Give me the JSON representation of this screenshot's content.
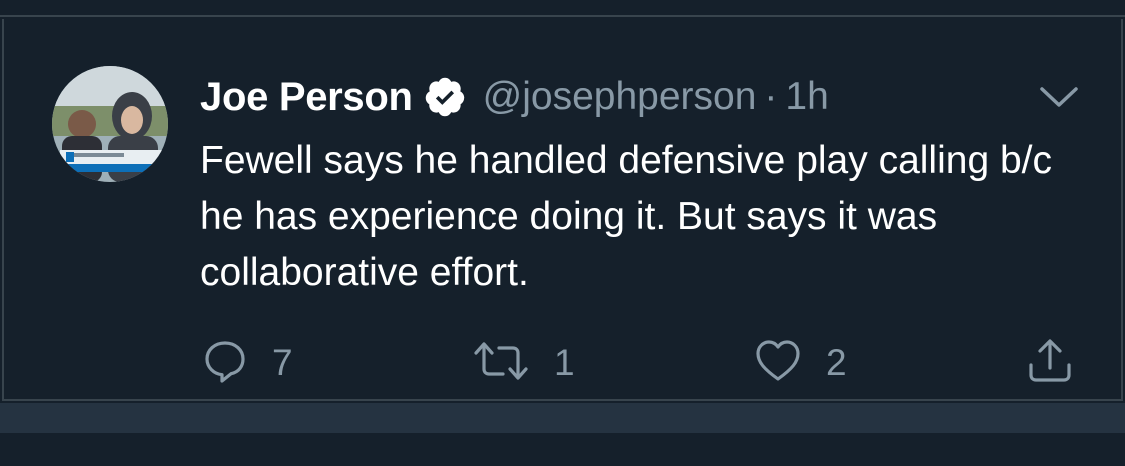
{
  "tweet": {
    "author": {
      "display_name": "Joe Person",
      "handle": "@josephperson",
      "verified": true
    },
    "separator": "·",
    "time": "1h",
    "text": "Fewell says he handled defensive play calling b/c he has experience doing it. But says it was collaborative effort.",
    "actions": {
      "reply_count": "7",
      "retweet_count": "1",
      "like_count": "2"
    }
  },
  "theme": {
    "background": "#15202b",
    "divider": "#38444d",
    "secondary_text": "#8899a6",
    "primary_text": "#ffffff",
    "verified_badge": "#ffffff"
  },
  "icons": {
    "verified": "verified-badge-icon",
    "caret": "chevron-down-icon",
    "reply": "reply-bubble-icon",
    "retweet": "retweet-icon",
    "like": "heart-icon",
    "share": "share-icon"
  }
}
